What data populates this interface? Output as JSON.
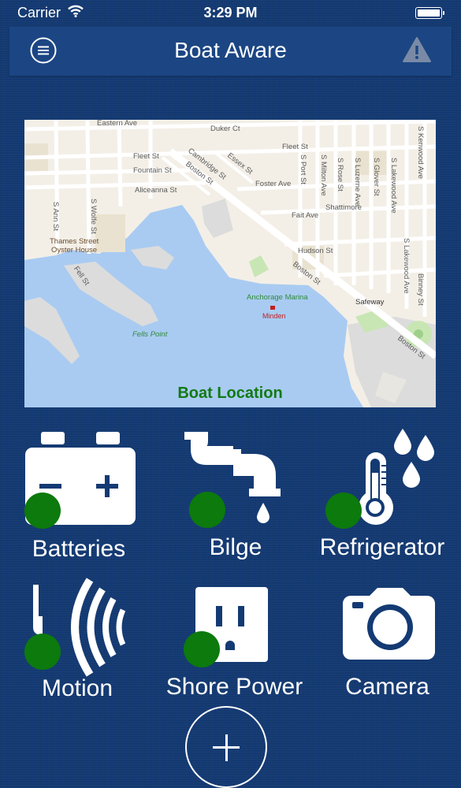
{
  "status_bar": {
    "carrier": "Carrier",
    "time": "3:29 PM",
    "battery_level": 1.0
  },
  "nav": {
    "title": "Boat Aware",
    "menu_icon": "hamburger-circle-icon",
    "alert_icon": "warning-triangle-icon"
  },
  "map": {
    "caption": "Boat Location",
    "streets": {
      "eastern_ave": "Eastern Ave",
      "duker_ct": "Duker Ct",
      "fleet_st_w": "Fleet St",
      "fleet_st_e": "Fleet St",
      "fountain_st": "Fountain St",
      "aliceanna_st": "Aliceanna St",
      "boston_st_a": "Boston St",
      "boston_st_b": "Boston St",
      "boston_st_c": "Boston St",
      "cambridge_st": "Cambridge St",
      "essex_st": "Essex St",
      "foster_ave": "Foster Ave",
      "fait_ave": "Fait Ave",
      "hudson_st": "Hudson St",
      "s_ann_st": "S Ann St",
      "s_wolfe_st": "S Wolfe St",
      "fell_st": "Fell St",
      "s_milton_ave": "S Milton Ave",
      "s_port_st": "S Port St",
      "s_rose_st": "S Rose St",
      "s_luzerne_ave": "S Luzerne Ave",
      "s_glover_st": "S Glover St",
      "s_lakewood_ave": "S Lakewood Ave",
      "s_lakewood_ave_2": "S Lakewood Ave",
      "binney_st": "Binney St",
      "s_kenwood_ave": "S Kenwood Ave"
    },
    "places": {
      "thames_street": "Thames Street",
      "oyster_house": "Oyster House",
      "fells_point": "Fells Point",
      "anchorage_marina": "Anchorage Marina",
      "minden": "Minden",
      "safeway": "Safeway",
      "shattimore": "Shattimore"
    },
    "colors": {
      "water": "#a9cbf2",
      "land": "#f3efe7",
      "pier": "#dcdcdc",
      "road": "#ffffff",
      "park": "#c8e6b4"
    }
  },
  "devices": [
    {
      "id": "batteries",
      "label": "Batteries",
      "icon": "car-battery-icon",
      "online": true
    },
    {
      "id": "bilge",
      "label": "Bilge",
      "icon": "leaking-pipe-icon",
      "online": true
    },
    {
      "id": "refrigerator",
      "label": "Refrigerator",
      "icon": "thermometer-droplets-icon",
      "online": true
    },
    {
      "id": "motion",
      "label": "Motion",
      "icon": "motion-sensor-icon",
      "online": true
    },
    {
      "id": "shore_power",
      "label": "Shore Power",
      "icon": "power-outlet-icon",
      "online": true
    },
    {
      "id": "camera",
      "label": "Camera",
      "icon": "camera-icon",
      "online": false
    }
  ],
  "add_button": {
    "icon": "plus-icon"
  },
  "colors": {
    "background": "#143a73",
    "nav": "#1b4683",
    "status_online": "#0c7a0c",
    "map_caption": "#137a13"
  }
}
